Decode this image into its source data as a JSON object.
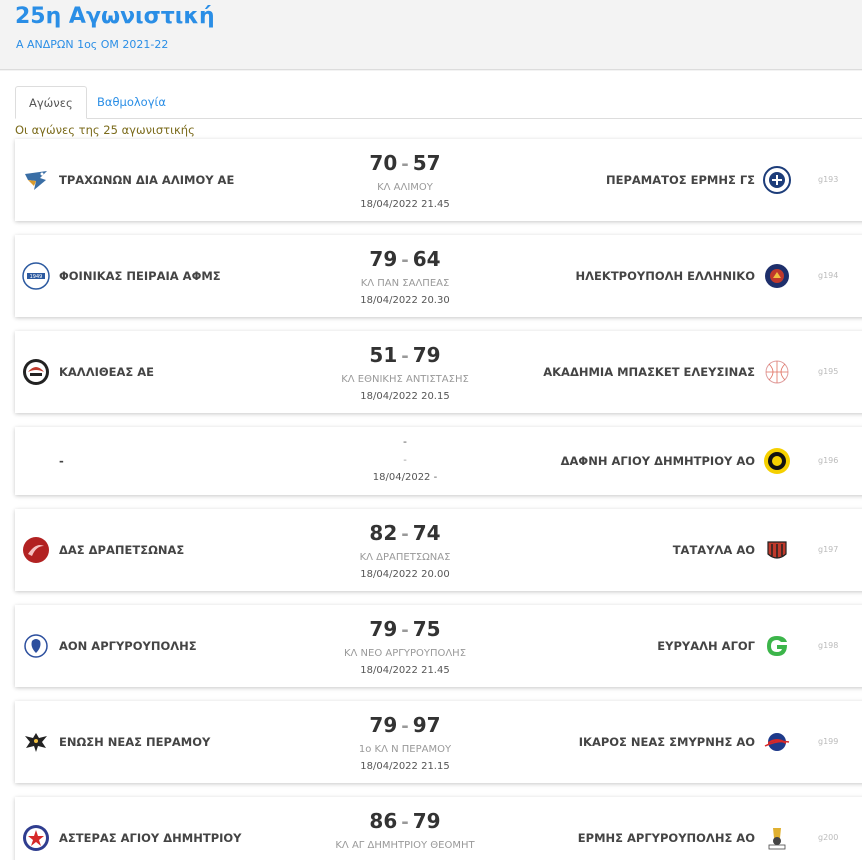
{
  "header": {
    "title": "25η Αγωνιστική",
    "subtitle": "Α ΑΝΔΡΩΝ 1ος ΟΜ 2021-22"
  },
  "tabs": [
    {
      "label": "Αγώνες",
      "active": true
    },
    {
      "label": "Βαθμολογία",
      "active": false
    }
  ],
  "caption": "Οι αγώνες της 25 αγωνιστικής",
  "colors": {
    "accent": "#2a8ee6",
    "caption": "#7a6a1a"
  },
  "matches": [
    {
      "home": "ΤΡΑΧΩΝΩΝ ΔΙΑ ΑΛΙΜΟΥ ΑΕ",
      "home_score": "70",
      "away_score": "57",
      "venue": "ΚΛ ΑΛΙΜΟΥ",
      "datetime": "18/04/2022 21.45",
      "away": "ΠΕΡΑΜΑΤΟΣ ΕΡΜΗΣ ΓΣ",
      "code": "g193",
      "home_logo": "bird-logo-icon",
      "away_logo": "round-blue-logo-icon"
    },
    {
      "home": "ΦΟΙΝΙΚΑΣ ΠΕΙΡΑΙΑ ΑΦΜΣ",
      "home_score": "79",
      "away_score": "64",
      "venue": "ΚΛ ΠΑΝ ΣΑΛΠΕΑΣ",
      "datetime": "18/04/2022 20.30",
      "away": "ΗΛΕΚΤΡΟΥΠΟΛΗ ΕΛΛΗΝΙΚΟ",
      "code": "g194",
      "home_logo": "phoenix-1949-logo-icon",
      "away_logo": "shield-red-blue-logo-icon"
    },
    {
      "home": "ΚΑΛΛΙΘΕΑΣ ΑΕ",
      "home_score": "51",
      "away_score": "79",
      "venue": "ΚΛ ΕΘΝΙΚΗΣ ΑΝΤΙΣΤΑΣΗΣ",
      "datetime": "18/04/2022 20.15",
      "away": "ΑΚΑΔΗΜΙΑ ΜΠΑΣΚΕΤ ΕΛΕΥΣΙΝΑΣ",
      "code": "g195",
      "home_logo": "red-black-circle-logo-icon",
      "away_logo": "basketball-outline-logo-icon"
    },
    {
      "home": "-",
      "home_score": "-",
      "away_score": "",
      "venue": "-",
      "datetime": "18/04/2022 -",
      "away": "ΔΑΦΝΗ ΑΓΙΟΥ ΔΗΜΗΤΡΙΟΥ ΑΟ",
      "code": "g196",
      "home_logo": "",
      "away_logo": "yellow-black-logo-icon"
    },
    {
      "home": "ΔΑΣ ΔΡΑΠΕΤΣΩΝΑΣ",
      "home_score": "82",
      "away_score": "74",
      "venue": "ΚΛ ΔΡΑΠΕΤΣΩΝΑΣ",
      "datetime": "18/04/2022 20.00",
      "away": "ΤΑΤΑΥΛΑ ΑΟ",
      "code": "g197",
      "home_logo": "red-swoosh-logo-icon",
      "away_logo": "red-black-stripes-logo-icon"
    },
    {
      "home": "ΑΟΝ ΑΡΓΥΡΟΥΠΟΛΗΣ",
      "home_score": "79",
      "away_score": "75",
      "venue": "ΚΛ ΝΕΟ ΑΡΓΥΡΟΥΠΟΛΗΣ",
      "datetime": "18/04/2022 21.45",
      "away": "ΕΥΡΥΑΛΗ ΑΓΟΓ",
      "code": "g198",
      "home_logo": "blue-crest-logo-icon",
      "away_logo": "green-text-logo-icon"
    },
    {
      "home": "ΕΝΩΣΗ ΝΕΑΣ ΠΕΡΑΜΟΥ",
      "home_score": "79",
      "away_score": "97",
      "venue": "1ο ΚΛ Ν ΠΕΡΑΜΟΥ",
      "datetime": "18/04/2022 21.15",
      "away": "ΙΚΑΡΟΣ ΝΕΑΣ ΣΜΥΡΝΗΣ ΑΟ",
      "code": "g199",
      "home_logo": "black-eagle-logo-icon",
      "away_logo": "red-blue-ball-logo-icon"
    },
    {
      "home": "ΑΣΤΕΡΑΣ ΑΓΙΟΥ ΔΗΜΗΤΡΙΟΥ",
      "home_score": "86",
      "away_score": "79",
      "venue": "ΚΛ ΑΓ ΔΗΜΗΤΡΙΟΥ ΘΕΟΜΗΤ",
      "datetime": "",
      "away": "ΕΡΜΗΣ ΑΡΓΥΡΟΥΠΟΛΗΣ ΑΟ",
      "code": "g200",
      "home_logo": "red-star-logo-icon",
      "away_logo": "hermes-logo-icon"
    }
  ]
}
